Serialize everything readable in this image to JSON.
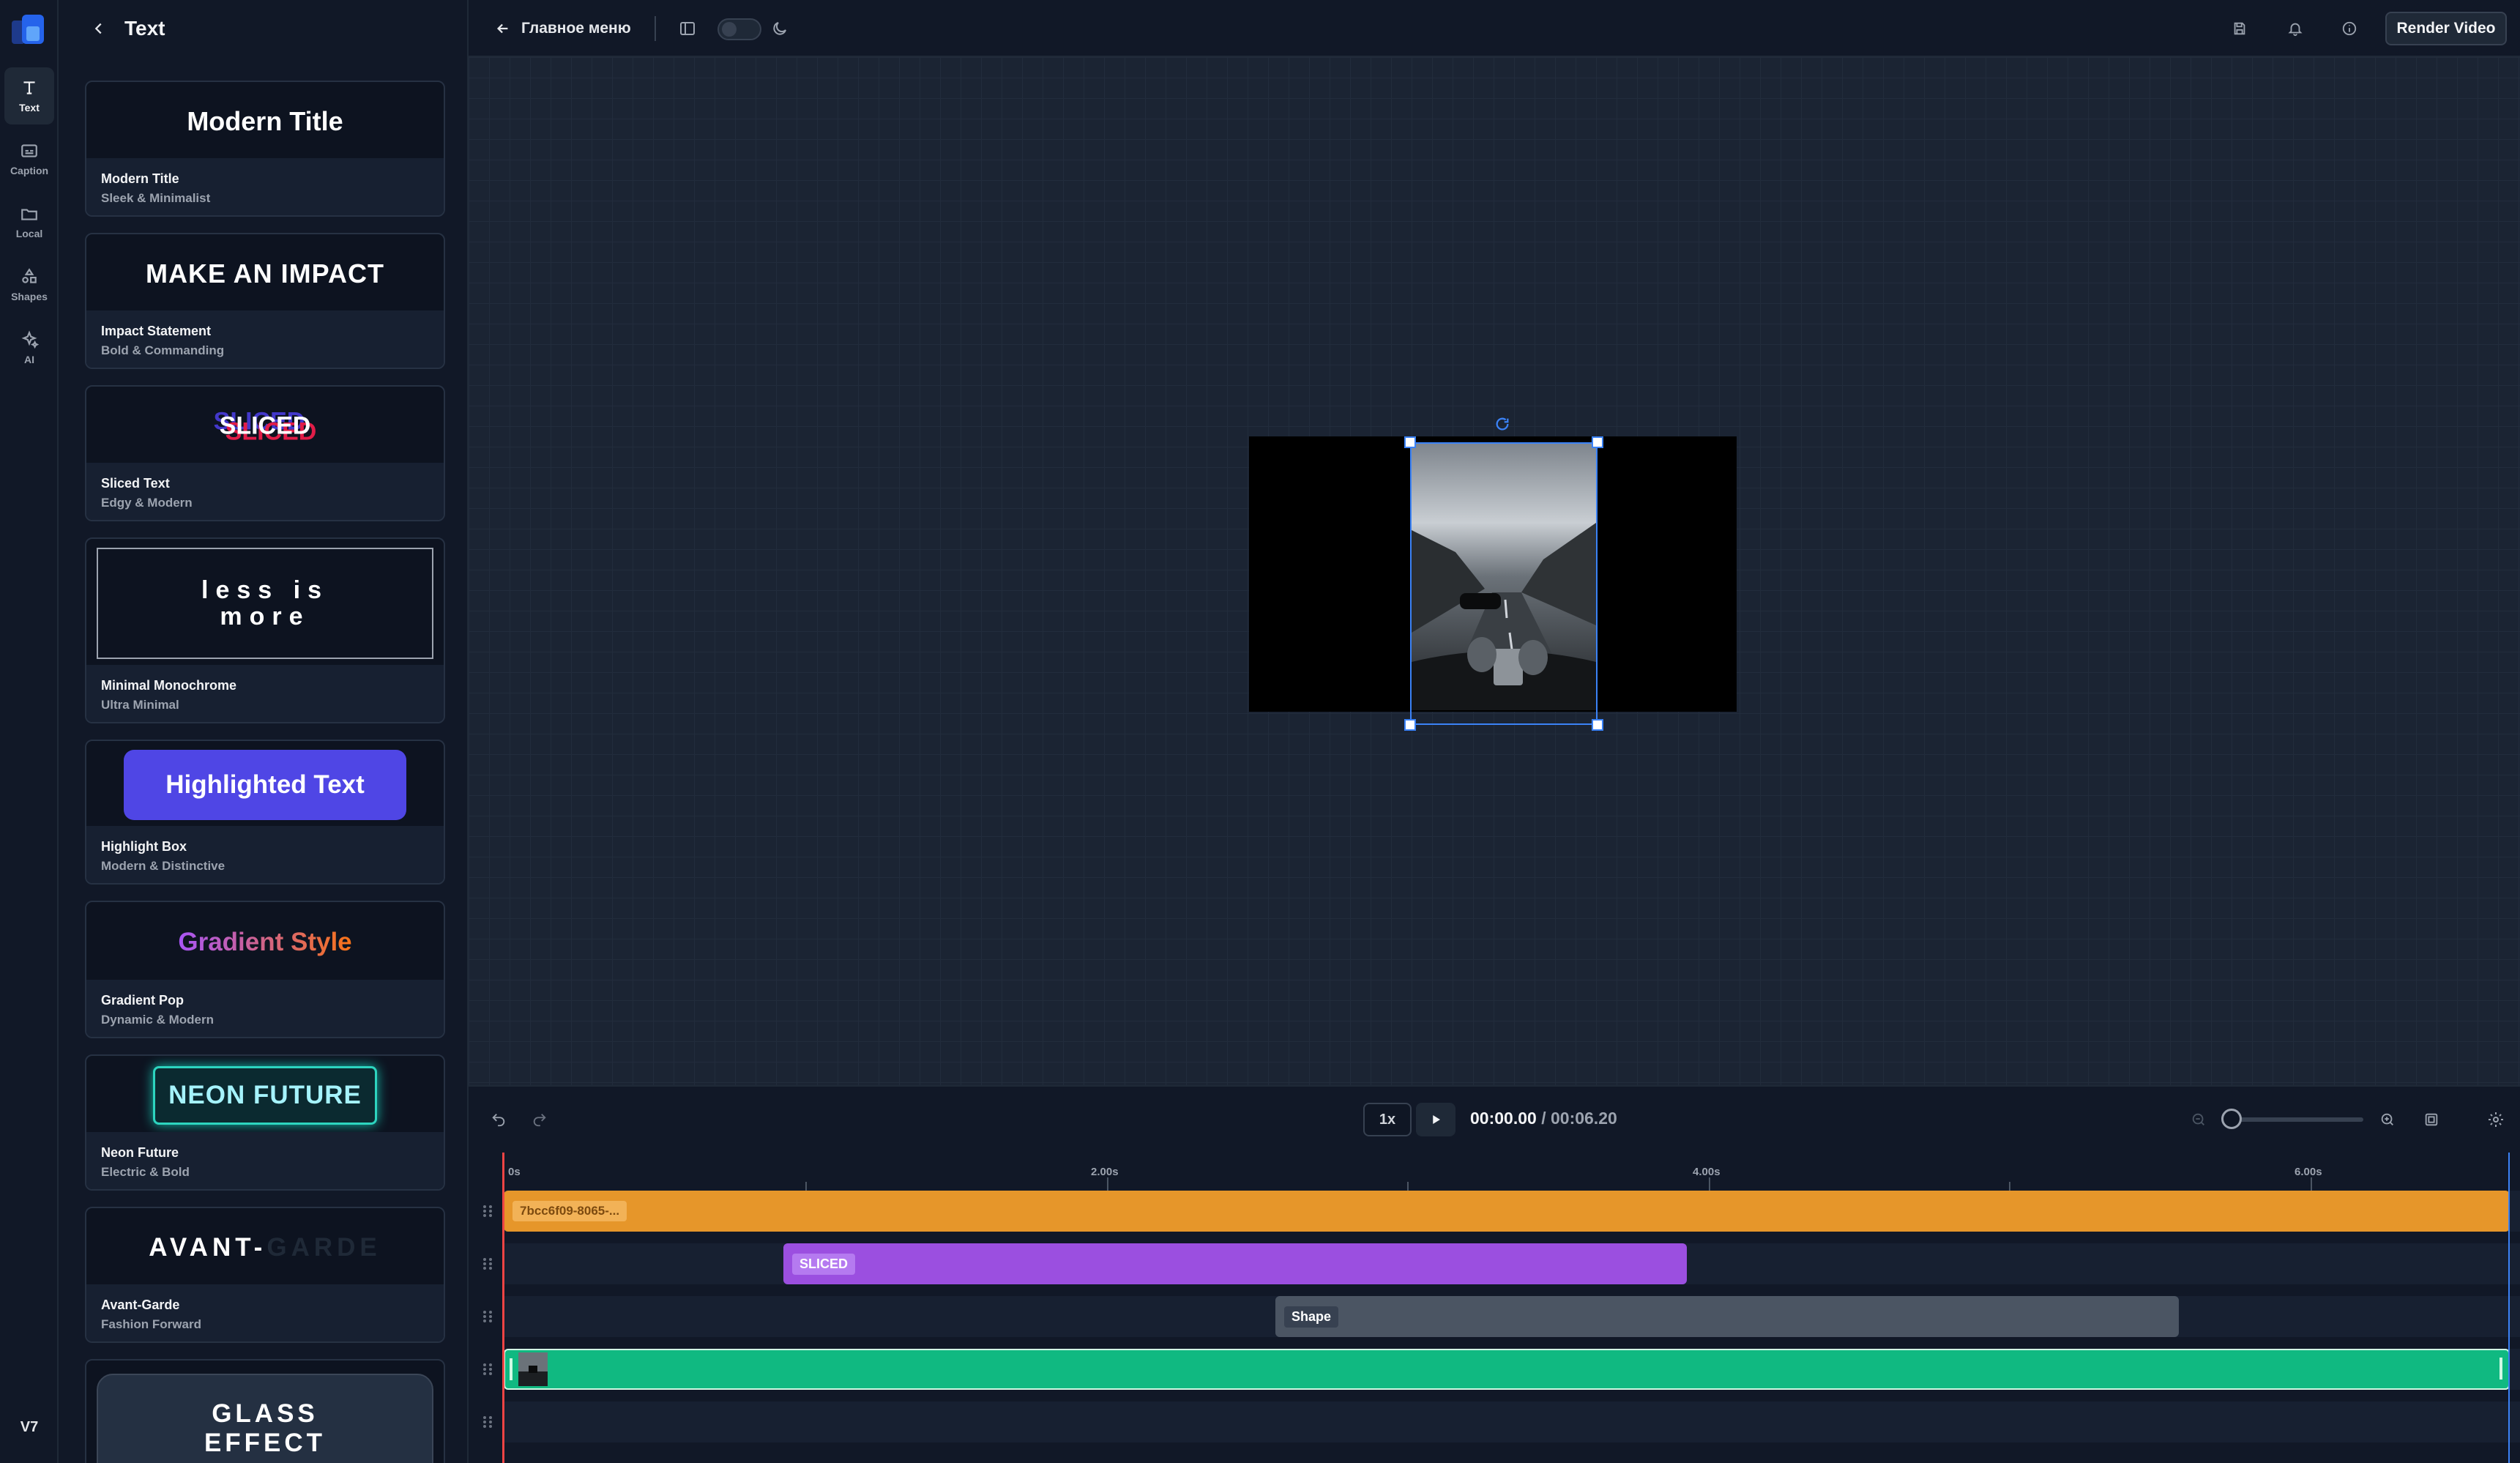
{
  "sidebar": {
    "items": [
      {
        "label": "Text",
        "icon": "text-icon"
      },
      {
        "label": "Caption",
        "icon": "caption-icon"
      },
      {
        "label": "Local",
        "icon": "folder-icon"
      },
      {
        "label": "Shapes",
        "icon": "shapes-icon"
      },
      {
        "label": "AI",
        "icon": "sparkles-icon"
      }
    ],
    "version": "V7"
  },
  "panel": {
    "title": "Text",
    "templates": [
      {
        "preview": "Modern Title",
        "name": "Modern Title",
        "desc": "Sleek & Minimalist"
      },
      {
        "preview": "MAKE AN IMPACT",
        "name": "Impact Statement",
        "desc": "Bold & Commanding"
      },
      {
        "preview": "SLICED",
        "name": "Sliced Text",
        "desc": "Edgy & Modern"
      },
      {
        "preview_line1": "less is",
        "preview_line2": "more",
        "name": "Minimal Monochrome",
        "desc": "Ultra Minimal"
      },
      {
        "preview": "Highlighted Text",
        "name": "Highlight Box",
        "desc": "Modern & Distinctive"
      },
      {
        "preview": "Gradient Style",
        "name": "Gradient Pop",
        "desc": "Dynamic & Modern"
      },
      {
        "preview": "NEON FUTURE",
        "name": "Neon Future",
        "desc": "Electric & Bold"
      },
      {
        "preview_a": "AVANT-",
        "preview_b": "GARDE",
        "name": "Avant-Garde",
        "desc": "Fashion Forward"
      },
      {
        "preview_line1": "GLASS",
        "preview_line2": "EFFECT"
      }
    ]
  },
  "topbar": {
    "back_label": "Главное меню",
    "render_label": "Render Video"
  },
  "player": {
    "speed": "1x",
    "current_time": "00:00.00",
    "separator": "/",
    "total_time": "00:06.20"
  },
  "timeline": {
    "ticks": [
      "0s",
      "2.00s",
      "4.00s",
      "6.00s"
    ],
    "tracks": [
      {
        "label": "7bcc6f09-8065-...",
        "color": "#e6962a"
      },
      {
        "label": "SLICED",
        "color": "#9b4fe0"
      },
      {
        "label": "Shape",
        "color": "#4b5563"
      },
      {
        "label": "",
        "color": "#10b981"
      }
    ]
  },
  "colors": {
    "accent": "#4f46e5",
    "selection": "#3b82f6",
    "playhead": "#ef4444"
  }
}
